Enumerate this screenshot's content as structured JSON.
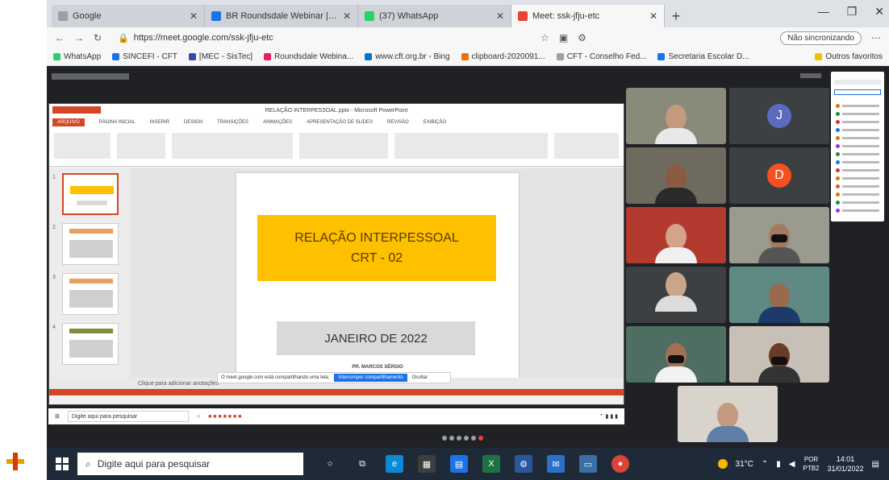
{
  "browser": {
    "tabs": [
      {
        "label": "Google",
        "color": "#9aa0a6"
      },
      {
        "label": "BR Roundsdale Webinar | Cam...",
        "color": "#1a73e8"
      },
      {
        "label": "(37) WhatsApp",
        "color": "#25d366"
      },
      {
        "label": "Meet: ssk-jfju-etc",
        "color": "#ea4335"
      }
    ],
    "url": "https://meet.google.com/ssk-jfju-etc",
    "not_sync_label": "Não sincronizando",
    "favorites": [
      {
        "label": "WhatsApp",
        "color": "#25d366"
      },
      {
        "label": "SINCEFI - CFT",
        "color": "#1a73e8"
      },
      {
        "label": "[MEC - SisTec]",
        "color": "#3949ab"
      },
      {
        "label": "Roundsdale Webina...",
        "color": "#e91e63"
      },
      {
        "label": "www.cft.org.br - Bing",
        "color": "#0078d4"
      },
      {
        "label": "clipboard-2020091...",
        "color": "#e8710a"
      },
      {
        "label": "CFT - Conselho Fed...",
        "color": "#9aa0a6"
      },
      {
        "label": "Secretaria Escolar D...",
        "color": "#1a73e8"
      }
    ],
    "favorites_other": "Outros favoritos"
  },
  "ppt": {
    "title": "RELAÇÃO INTERPESSOAL.pptx - Microsoft PowerPoint",
    "tabs": [
      "ARQUIVO",
      "PÁGINA INICIAL",
      "INSERIR",
      "DESIGN",
      "TRANSIÇÕES",
      "ANIMAÇÕES",
      "APRESENTAÇÃO DE SLIDES",
      "REVISÃO",
      "EXIBIÇÃO"
    ],
    "slide_title_line1": "RELAÇÃO INTERPESSOAL",
    "slide_title_line2": "CRT - 02",
    "slide_date": "JANEIRO DE 2022",
    "slide_author": "PR. MARCOS SÉRGIO",
    "notes_placeholder": "Clique para adicionar anotações",
    "share_notice": "O meet.google.com está compartilhando uma tela.",
    "share_stop": "Interromper compartilhamento",
    "share_hide": "Ocultar",
    "inner_search": "Digite aqui para pesquisar"
  },
  "participants": {
    "avatar_j": {
      "letter": "J",
      "color": "#5c6bc0"
    },
    "avatar_d": {
      "letter": "D",
      "color": "#f4511e"
    }
  },
  "taskbar": {
    "search_placeholder": "Digite aqui para pesquisar",
    "temperature": "31°C",
    "lang_top": "POR",
    "lang_bottom": "PTB2",
    "time": "14:01",
    "date": "31/01/2022"
  }
}
